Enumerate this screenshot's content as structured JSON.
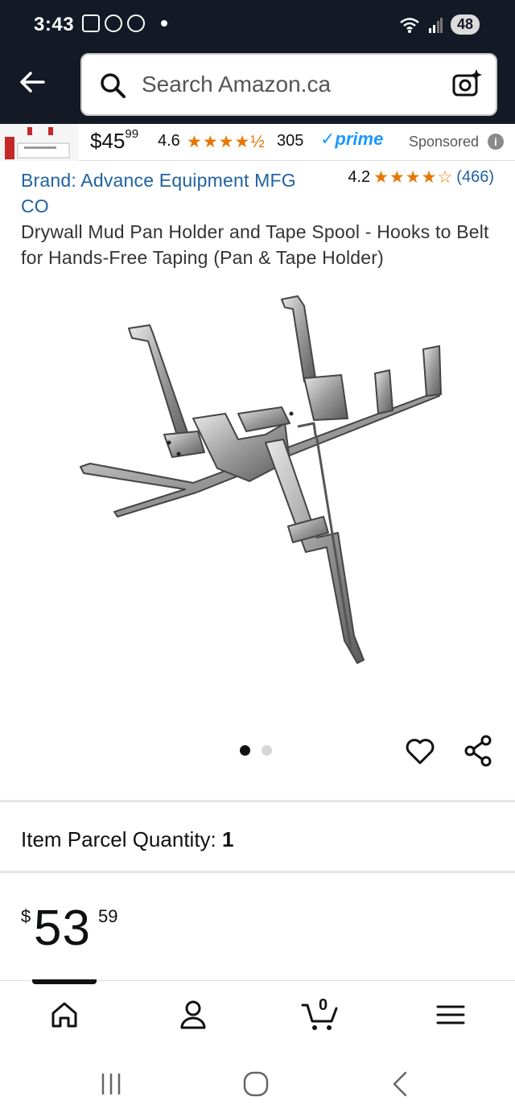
{
  "status_bar": {
    "time": "3:43",
    "battery": "48"
  },
  "header": {
    "search_placeholder": "Search Amazon.ca"
  },
  "sponsored": {
    "price_whole": "$45",
    "price_fraction": "99",
    "rating": "4.6",
    "stars": "★★★★½",
    "review_count": "305",
    "prime_label": "✓prime",
    "sponsored_label": "Sponsored",
    "info_glyph": "i"
  },
  "product": {
    "brand": "Brand: Advance Equipment MFG CO",
    "rating": "4.2",
    "stars": "★★★★☆",
    "review_count": "(466)",
    "title": "Drywall Mud Pan Holder and Tape Spool - Hooks to Belt for Hands-Free Taping (Pan & Tape Holder)",
    "image_count": 2,
    "active_image": 0
  },
  "quantity": {
    "label": "Item Parcel Quantity:",
    "value": "1"
  },
  "price": {
    "currency": "$",
    "whole": "53",
    "fraction": "59"
  },
  "bottom_nav": {
    "items": [
      "home",
      "account",
      "cart",
      "menu"
    ],
    "cart_count": "0"
  },
  "colors": {
    "header_bg": "#131a26",
    "link": "#2162a1",
    "star": "#e77600",
    "prime": "#1a98ff"
  },
  "icons": [
    "back-arrow-icon",
    "search-icon",
    "camera-icon",
    "heart-icon",
    "share-icon",
    "home-icon",
    "account-icon",
    "cart-icon",
    "menu-icon",
    "recent-apps-icon",
    "home-circle-icon",
    "back-chevron-icon"
  ]
}
